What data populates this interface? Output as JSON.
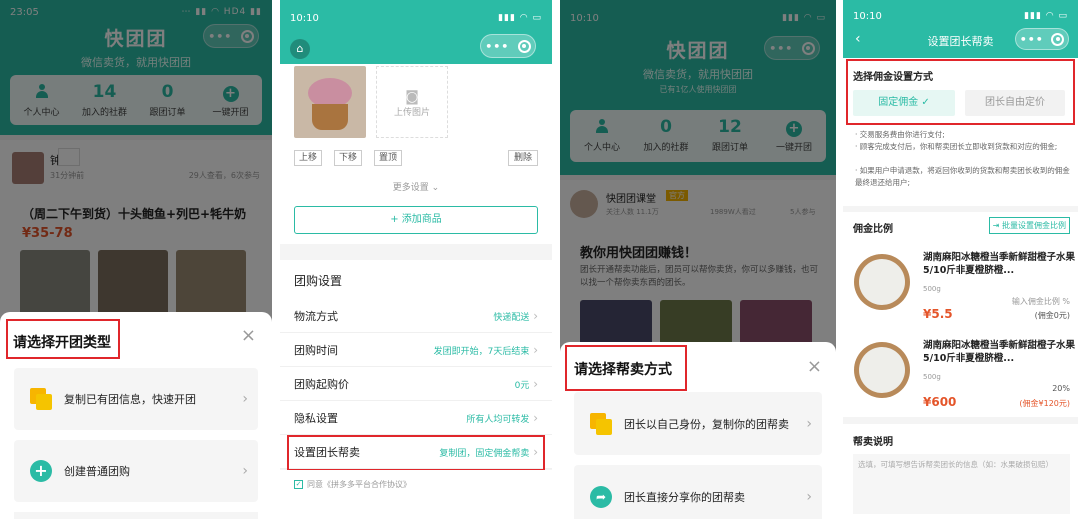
{
  "panel1": {
    "status_time": "23:05",
    "status_icons": "⋯ ▮▮ ◠ HD4 ▮▮",
    "app_name": "快团团",
    "slogan": "微信卖货，就用快团团",
    "stats": [
      {
        "label": "个人中心",
        "icon": "person-icon"
      },
      {
        "label": "加入的社群",
        "value": "14"
      },
      {
        "label": "跟团订单",
        "value": "0"
      },
      {
        "label": "一键开团",
        "icon": "plus-circle-icon"
      }
    ],
    "group_card": {
      "leader_name": "钟",
      "posted_ago": "31分钟前",
      "views": "29人查看，6次参与",
      "title": "（周二下午到货）十头鲍鱼+列巴+牦牛奶",
      "price": "¥35-78"
    },
    "sheet": {
      "title": "请选择开团类型",
      "options": [
        {
          "label": "复制已有团信息，快速开团",
          "icon": "copy-icon"
        },
        {
          "label": "创建普通团购",
          "icon": "plus-icon"
        }
      ]
    }
  },
  "panel2": {
    "status_time": "10:10",
    "upload_label": "上传图片",
    "buttons": [
      "上移",
      "下移",
      "置顶",
      "删除"
    ],
    "more_settings": "更多设置 ⌄",
    "add_goods": "+ 添加商品",
    "section_title": "团购设置",
    "rows": [
      {
        "label": "物流方式",
        "value": "快递配送"
      },
      {
        "label": "团购时间",
        "value": "发团即开始，7天后结束"
      },
      {
        "label": "团购起购价",
        "value": "0元"
      },
      {
        "label": "隐私设置",
        "value": "所有人均可转发"
      },
      {
        "label": "设置团长帮卖",
        "value": "复制团，固定佣金帮卖"
      }
    ],
    "agreement": "同意《拼多多平台合作协议》"
  },
  "panel3": {
    "status_time": "10:10",
    "app_name": "快团团",
    "slogan": "微信卖货，就用快团团",
    "joined_text": "已有1亿人使用快团团",
    "stats": [
      {
        "label": "个人中心"
      },
      {
        "label": "加入的社群",
        "value": "0"
      },
      {
        "label": "跟团订单",
        "value": "12"
      },
      {
        "label": "一键开团"
      }
    ],
    "class_card": {
      "name": "快团团课堂",
      "badge": "官方",
      "sub": "关注人数 11.1万",
      "views": "1989W人看过",
      "count": "5人参与"
    },
    "teach_title": "教你用快团团赚钱！",
    "teach_desc": "团长开通帮卖功能后，团员可以帮你卖货，你可以多赚钱，也可以找一个帮你卖东西的团长。",
    "sheet": {
      "title": "请选择帮卖方式",
      "options": [
        {
          "label": "团长以自己身份，复制你的团帮卖",
          "icon": "copy-icon"
        },
        {
          "label": "团长直接分享你的团帮卖",
          "icon": "share-icon"
        }
      ]
    }
  },
  "panel4": {
    "status_time": "10:10",
    "nav_title": "设置团长帮卖",
    "commission_title": "选择佣金设置方式",
    "seg_fixed": "固定佣金 ✓",
    "seg_free": "团长自由定价",
    "notes": [
      "· 交易服务费由你进行支付;",
      "· 顾客完成支付后，你和帮卖团长立即收到货款和对应的佣金;",
      "· 如果用户申请退款，将返回你收到的货款和帮卖团长收到的佣金最终退还给用户;"
    ],
    "ratio_title": "佣金比例",
    "batch_button": "批量设置佣金比例",
    "products": [
      {
        "name": "湖南麻阳冰糖橙当季新鲜甜橙子水果5/10斤非夏橙脐橙...",
        "spec": "500g",
        "price": "¥5.5",
        "ratio_label": "输入佣金比例 %",
        "commission": "(佣金0元)"
      },
      {
        "name": "湖南麻阳冰糖橙当季新鲜甜橙子水果5/10斤非夏橙脐橙...",
        "spec": "500g",
        "price": "¥600",
        "ratio_label": "20%",
        "commission": "(佣金¥120元)"
      }
    ],
    "explain_title": "帮卖说明",
    "explain_placeholder": "选填，可填写想告诉帮卖团长的信息（如：水果破损包赔）"
  }
}
